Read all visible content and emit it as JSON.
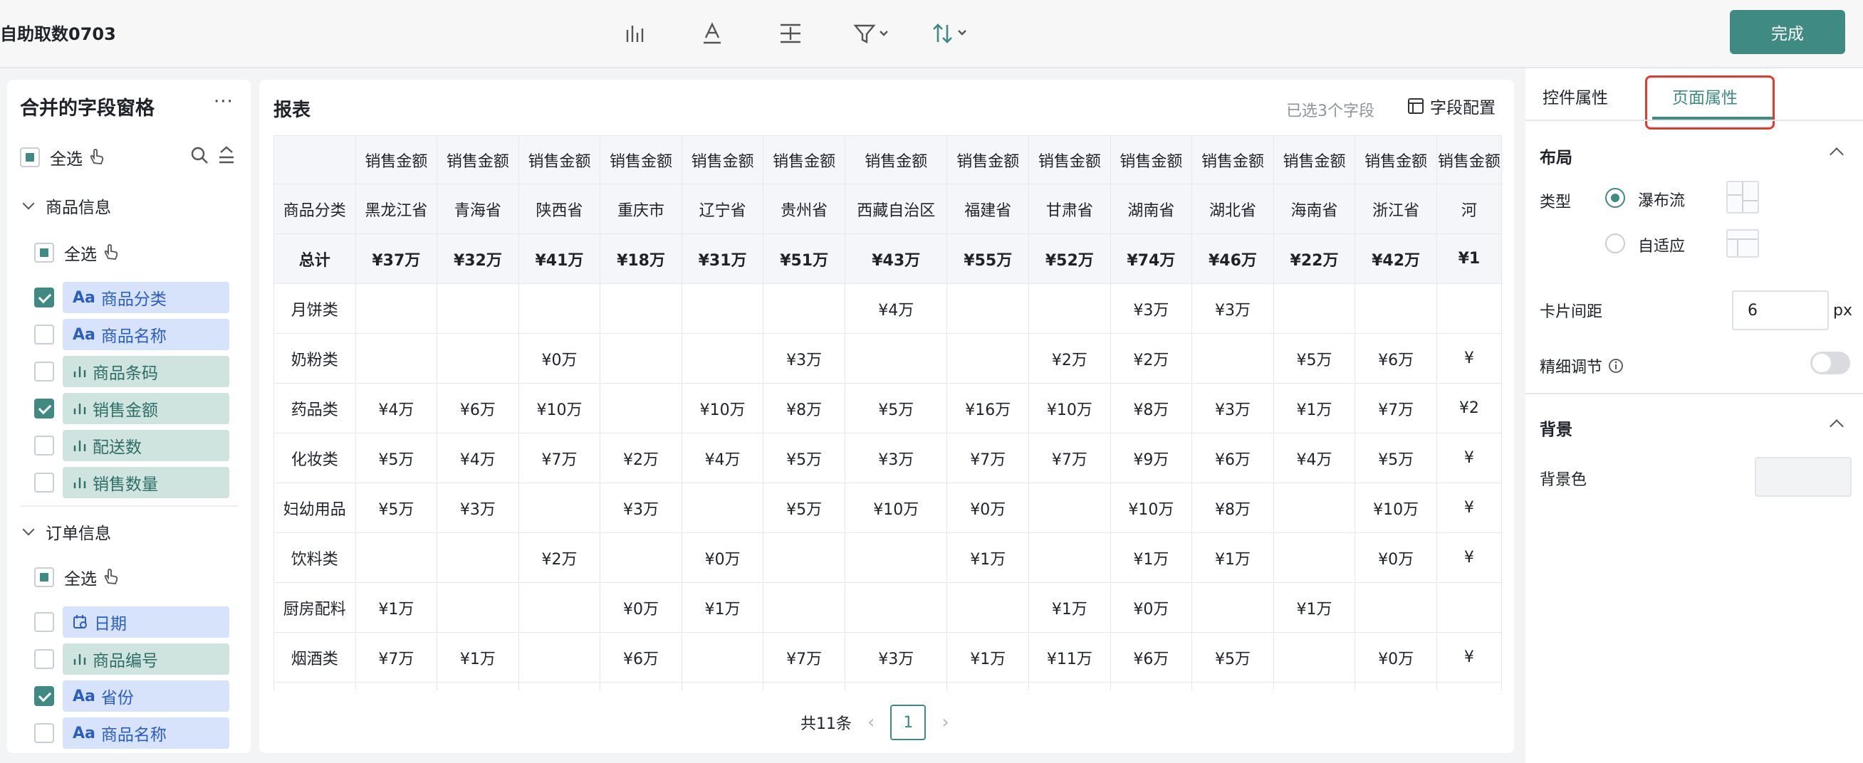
{
  "app": {
    "title": "自助取数0703",
    "done_label": "完成"
  },
  "toolbar": {
    "icons": [
      "bar-chart-icon",
      "text-format-icon",
      "column-align-icon",
      "filter-icon",
      "sort-icon"
    ]
  },
  "field_panel": {
    "title": "合并的字段窗格",
    "more": "···",
    "select_all": "全选",
    "groups": [
      {
        "name": "商品信息",
        "select_all": "全选",
        "fields": [
          {
            "label": "商品分类",
            "type": "Aa",
            "checked": true
          },
          {
            "label": "商品名称",
            "type": "Aa",
            "checked": false
          },
          {
            "label": "商品条码",
            "type": "measure",
            "checked": false
          },
          {
            "label": "销售金额",
            "type": "measure",
            "checked": true
          },
          {
            "label": "配送数",
            "type": "measure",
            "checked": false
          },
          {
            "label": "销售数量",
            "type": "measure",
            "checked": false
          }
        ]
      },
      {
        "name": "订单信息",
        "select_all": "全选",
        "fields": [
          {
            "label": "日期",
            "type": "date",
            "checked": false
          },
          {
            "label": "商品编号",
            "type": "measure",
            "checked": false
          },
          {
            "label": "省份",
            "type": "Aa",
            "checked": true
          },
          {
            "label": "商品名称",
            "type": "Aa",
            "checked": false
          }
        ]
      }
    ]
  },
  "report": {
    "title": "报表",
    "selected_info": "已选3个字段",
    "config_label": "字段配置",
    "measure_header": "销售金额",
    "row_header": "商品分类",
    "total_label": "总计",
    "provinces": [
      "黑龙江省",
      "青海省",
      "陕西省",
      "重庆市",
      "辽宁省",
      "贵州省",
      "西藏自治区",
      "福建省",
      "甘肃省",
      "湖南省",
      "湖北省",
      "海南省",
      "浙江省",
      "河"
    ],
    "totals": [
      "¥37万",
      "¥32万",
      "¥41万",
      "¥18万",
      "¥31万",
      "¥51万",
      "¥43万",
      "¥55万",
      "¥52万",
      "¥74万",
      "¥46万",
      "¥22万",
      "¥42万",
      "¥1"
    ],
    "rows": [
      {
        "name": "月饼类",
        "cells": [
          "",
          "",
          "",
          "",
          "",
          "",
          "¥4万",
          "",
          "",
          "¥3万",
          "¥3万",
          "",
          "",
          ""
        ]
      },
      {
        "name": "奶粉类",
        "cells": [
          "",
          "",
          "¥0万",
          "",
          "",
          "¥3万",
          "",
          "",
          "¥2万",
          "¥2万",
          "",
          "¥5万",
          "¥6万",
          "¥"
        ]
      },
      {
        "name": "药品类",
        "cells": [
          "¥4万",
          "¥6万",
          "¥10万",
          "",
          "¥10万",
          "¥8万",
          "¥5万",
          "¥16万",
          "¥10万",
          "¥8万",
          "¥3万",
          "¥1万",
          "¥7万",
          "¥2"
        ]
      },
      {
        "name": "化妆类",
        "cells": [
          "¥5万",
          "¥4万",
          "¥7万",
          "¥2万",
          "¥4万",
          "¥5万",
          "¥3万",
          "¥7万",
          "¥7万",
          "¥9万",
          "¥6万",
          "¥4万",
          "¥5万",
          "¥"
        ]
      },
      {
        "name": "妇幼用品",
        "cells": [
          "¥5万",
          "¥3万",
          "",
          "¥3万",
          "",
          "¥5万",
          "¥10万",
          "¥0万",
          "",
          "¥10万",
          "¥8万",
          "",
          "¥10万",
          "¥"
        ]
      },
      {
        "name": "饮料类",
        "cells": [
          "",
          "",
          "¥2万",
          "",
          "¥0万",
          "",
          "",
          "¥1万",
          "",
          "¥1万",
          "¥1万",
          "",
          "¥0万",
          "¥"
        ]
      },
      {
        "name": "厨房配料",
        "cells": [
          "¥1万",
          "",
          "",
          "¥0万",
          "¥1万",
          "",
          "",
          "",
          "¥1万",
          "¥0万",
          "",
          "¥1万",
          "",
          ""
        ]
      },
      {
        "name": "烟酒类",
        "cells": [
          "¥7万",
          "¥1万",
          "",
          "¥6万",
          "",
          "¥7万",
          "¥3万",
          "¥1万",
          "¥11万",
          "¥6万",
          "¥5万",
          "",
          "¥0万",
          "¥"
        ]
      },
      {
        "name": "",
        "cells": [
          "",
          "",
          "",
          "",
          "",
          "",
          "",
          "",
          "",
          "",
          "",
          "",
          "",
          ""
        ]
      }
    ],
    "pager": {
      "total": "共11条",
      "page": "1",
      "prev": "‹",
      "next": "›"
    }
  },
  "properties": {
    "tabs": [
      "控件属性",
      "页面属性"
    ],
    "active_tab": "页面属性",
    "layout": {
      "title": "布局",
      "type_label": "类型",
      "options": [
        "瀑布流",
        "自适应"
      ],
      "selected": "瀑布流",
      "gap_label": "卡片间距",
      "gap_value": "6",
      "gap_unit": "px",
      "fine_tune_label": "精细调节",
      "fine_tune_on": false
    },
    "background": {
      "title": "背景",
      "color_label": "背景色",
      "color_value": "#f2f3f5"
    }
  },
  "colors": {
    "accent": "#3f8a82",
    "highlight": "#e23a2e",
    "dim_field": "#d7e2fb",
    "measure_field": "#cfe3df"
  }
}
